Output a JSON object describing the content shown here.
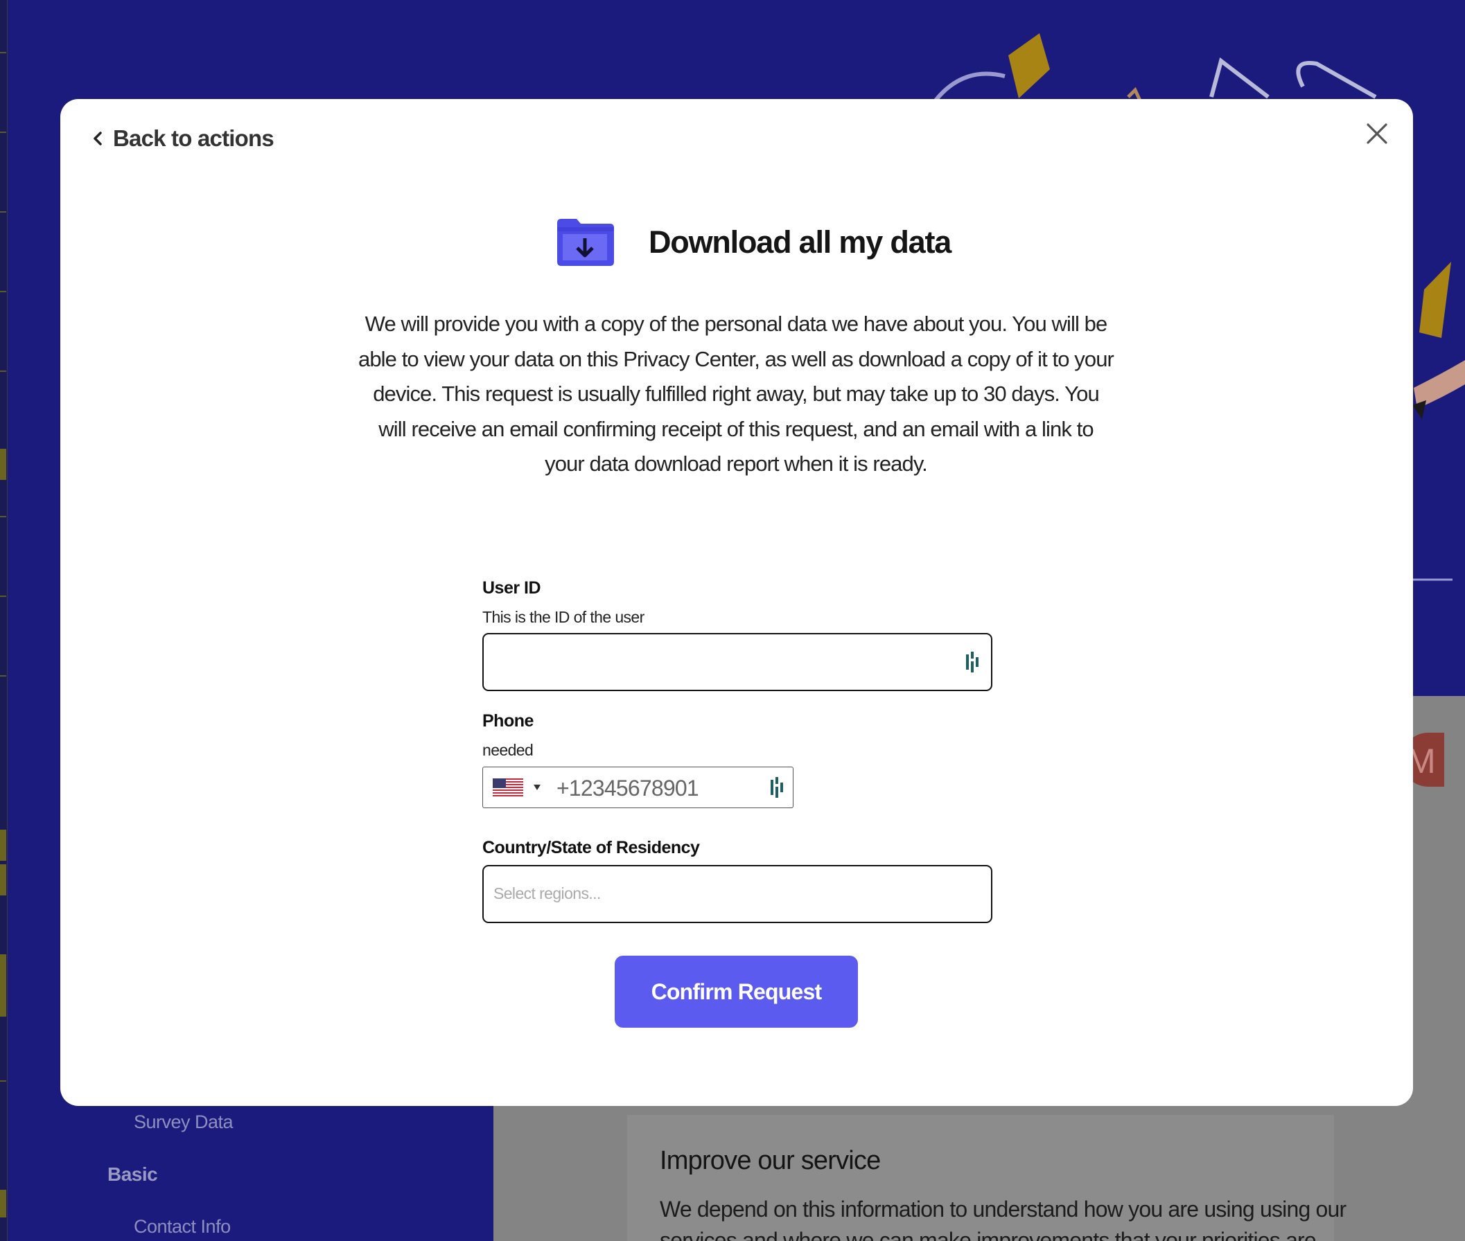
{
  "background": {
    "sidebar": {
      "sub_item_survey": "Survey Data",
      "section_basic": "Basic",
      "sub_item_contact": "Contact Info"
    },
    "card": {
      "title": "Improve our service",
      "text_line1": "We depend on this information to understand how you are using using our",
      "text_line2": "services and where we can make improvements that your priorities are."
    },
    "avatar_letter": "M"
  },
  "modal": {
    "back_label": "Back to actions",
    "title": "Download all my data",
    "description": "We will provide you with a copy of the personal data we have about you. You will be able to view your data on this Privacy Center, as well as download a copy of it to your device. This request is usually fulfilled right away, but may take up to 30 days. You will receive an email confirming receipt of this request, and an email with a link to your data download report when it is ready.",
    "fields": {
      "user_id": {
        "label": "User ID",
        "help": "This is the ID of the user",
        "value": ""
      },
      "phone": {
        "label": "Phone",
        "help": "needed",
        "country": "US",
        "placeholder": "+12345678901"
      },
      "residency": {
        "label": "Country/State of Residency",
        "placeholder": "Select regions..."
      }
    },
    "confirm_label": "Confirm Request"
  },
  "colors": {
    "hero_background": "#1b1b7e",
    "primary_button": "#5b5bef",
    "folder_icon": "#4b4be6"
  },
  "icons": [
    "chevron-left-icon",
    "close-icon",
    "folder-download-icon",
    "us-flag-icon",
    "password-manager-icon"
  ]
}
